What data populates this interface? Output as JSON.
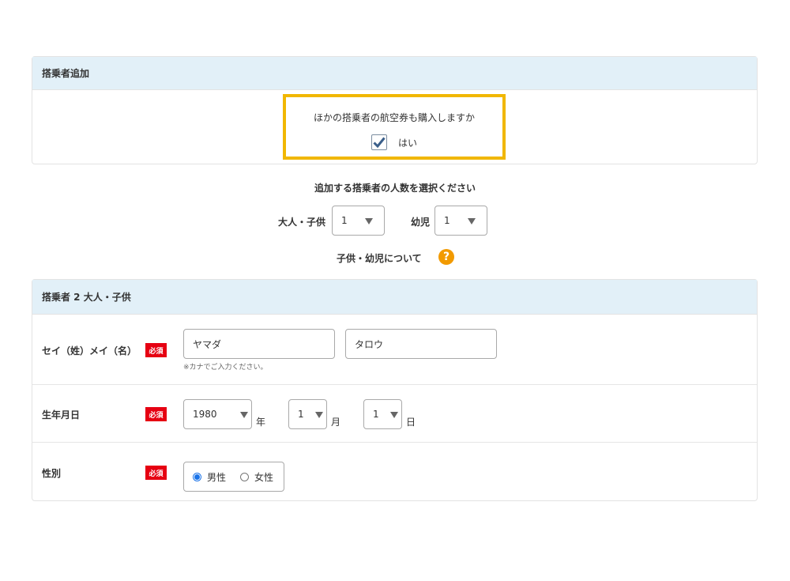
{
  "add_section": {
    "title": "搭乗者追加",
    "question": "ほかの搭乗者の航空券も購入しますか",
    "yes_label": "はい",
    "checked": true
  },
  "count_section": {
    "prompt": "追加する搭乗者の人数を選択ください",
    "adult_child_label": "大人・子供",
    "adult_child_value": "1",
    "infant_label": "幼児",
    "infant_value": "1",
    "about_link": "子供・幼児について",
    "help_icon": "question-circle-icon"
  },
  "passenger_section": {
    "title": "搭乗者 2 大人・子供",
    "required_badge": "必須",
    "name": {
      "label": "セイ（姓）メイ（名）",
      "last_name_value": "ヤマダ",
      "first_name_value": "タロウ",
      "hint": "※カナでご入力ください。"
    },
    "birthdate": {
      "label": "生年月日",
      "year_value": "1980",
      "year_unit": "年",
      "month_value": "1",
      "month_unit": "月",
      "day_value": "1",
      "day_unit": "日"
    },
    "gender": {
      "label": "性別",
      "male": "男性",
      "female": "女性",
      "selected": "男性"
    }
  },
  "colors": {
    "header_bg": "#e2f0f8",
    "highlight": "#f1b700",
    "required": "#e60012",
    "help_icon": "#f29a00",
    "radio_selected": "#1a73e8"
  }
}
